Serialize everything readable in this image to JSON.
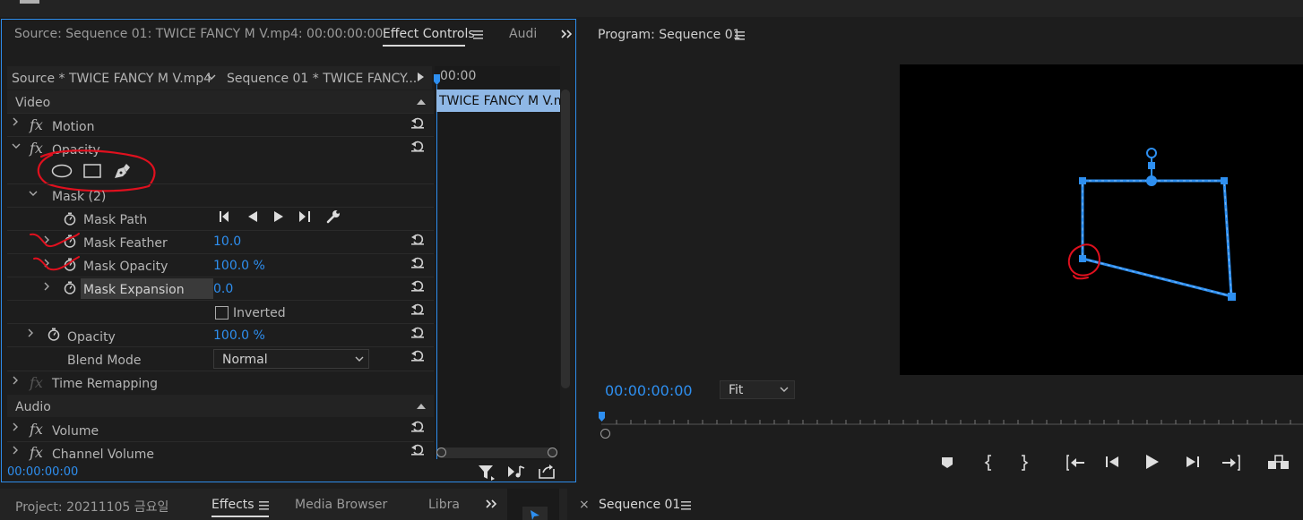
{
  "effect_panel": {
    "source_tab": "Source: Sequence 01: TWICE FANCY M V.mp4: 00:00:00:00",
    "effect_controls_tab": "Effect Controls",
    "audio_tab": "Audi",
    "source_clip": "Source * TWICE FANCY M V.mp4",
    "sequence_clip": "Sequence 01 * TWICE FANCY...",
    "timeline_time": "00:00",
    "clip_label": "TWICE FANCY M V.m",
    "video_header": "Video",
    "motion": "Motion",
    "opacity": "Opacity",
    "mask": "Mask (2)",
    "mask_path": "Mask Path",
    "mask_feather": "Mask Feather",
    "mask_feather_value": "10.0",
    "mask_opacity": "Mask Opacity",
    "mask_opacity_value": "100.0 %",
    "mask_expansion": "Mask Expansion",
    "mask_expansion_value": "0.0",
    "inverted": "Inverted",
    "opacity_prop": "Opacity",
    "opacity_value": "100.0 %",
    "blend_mode": "Blend Mode",
    "blend_mode_value": "Normal",
    "time_remapping": "Time Remapping",
    "audio_header": "Audio",
    "volume": "Volume",
    "channel_volume": "Channel Volume",
    "timecode": "00:00:00:00",
    "fx_symbol": "fx"
  },
  "program": {
    "title": "Program: Sequence 01",
    "timecode": "00:00:00:00",
    "zoom": "Fit"
  },
  "bottom": {
    "project_tab": "Project: 20211105 금요일",
    "effects_tab": "Effects",
    "media_browser_tab": "Media Browser",
    "libraries_tab": "Libra",
    "sequence_tab": "Sequence 01",
    "close_symbol": "×"
  },
  "colors": {
    "accent": "#2e8ff0",
    "annotation": "#e0101e",
    "panel": "#1d1d1d"
  }
}
